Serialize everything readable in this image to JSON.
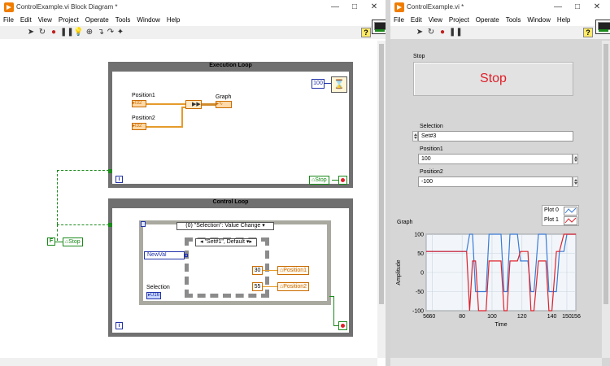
{
  "block_diagram": {
    "title": "ControlExample.vi Block Diagram *",
    "menu": [
      "File",
      "Edit",
      "View",
      "Project",
      "Operate",
      "Tools",
      "Window",
      "Help"
    ],
    "execution_loop": {
      "title": "Execution Loop",
      "position1_label": "Position1",
      "position2_label": "Position2",
      "graph_label": "Graph",
      "wait_constant": "100",
      "stop_local": "Stop",
      "iteration_symbol": "i"
    },
    "control_loop": {
      "title": "Control Loop",
      "event_selector": "(0) \"Selection\": Value Change",
      "case_selector": "\"Set#1\", Default",
      "newval_label": "NewVal",
      "selection_label": "Selection",
      "const_1": "30",
      "const_2": "55",
      "local_1": "Position1",
      "local_2": "Position2",
      "iteration_symbol": "i"
    },
    "outside": {
      "false_constant": "F",
      "stop_local": "Stop"
    }
  },
  "front_panel": {
    "title": "ControlExample.vi *",
    "menu": [
      "File",
      "Edit",
      "View",
      "Project",
      "Operate",
      "Tools",
      "Window",
      "Help"
    ],
    "stop": {
      "label": "Stop",
      "button_text": "Stop"
    },
    "selection": {
      "label": "Selection",
      "value": "Set#3"
    },
    "position1": {
      "label": "Position1",
      "value": "100"
    },
    "position2": {
      "label": "Position2",
      "value": "-100"
    },
    "graph": {
      "label": "Graph",
      "legend": [
        "Plot 0",
        "Plot 1"
      ]
    }
  },
  "colors": {
    "stop_text": "#e0202a",
    "plot0": "#3a7bd5",
    "plot1": "#e0202a",
    "wire_orange": "#e59b2b",
    "wire_green": "#1a8a1a"
  },
  "chart_data": {
    "type": "line",
    "title": "Graph",
    "xlabel": "Time",
    "ylabel": "Amplitude",
    "xlim": [
      56,
      156
    ],
    "ylim": [
      -100,
      100
    ],
    "xticks": [
      "56",
      "60",
      "80",
      "100",
      "120",
      "140",
      "150",
      "156"
    ],
    "yticks": [
      "100",
      "50",
      "0",
      "-50",
      "-100"
    ],
    "grid": true,
    "legend": "top-right",
    "series": [
      {
        "name": "Plot 0",
        "x": [
          56,
          83,
          85,
          87,
          89,
          96,
          98,
          106,
          108,
          110,
          112,
          117,
          119,
          124,
          126,
          128,
          131,
          136,
          138,
          143,
          145,
          148,
          150,
          152,
          156
        ],
        "y": [
          55,
          55,
          100,
          100,
          -50,
          -50,
          100,
          100,
          -50,
          -50,
          100,
          100,
          30,
          30,
          -50,
          -50,
          100,
          100,
          -50,
          -50,
          55,
          55,
          100,
          100,
          100
        ]
      },
      {
        "name": "Plot 1",
        "x": [
          56,
          83,
          85,
          87,
          89,
          91,
          96,
          98,
          106,
          108,
          110,
          112,
          117,
          119,
          121,
          124,
          126,
          128,
          131,
          136,
          138,
          140,
          143,
          145,
          148,
          150,
          152,
          156
        ],
        "y": [
          55,
          55,
          -100,
          30,
          30,
          -100,
          -100,
          30,
          30,
          -100,
          -100,
          30,
          30,
          55,
          55,
          55,
          -100,
          -100,
          30,
          30,
          -100,
          -100,
          55,
          55,
          100,
          100,
          100,
          100
        ]
      }
    ]
  }
}
